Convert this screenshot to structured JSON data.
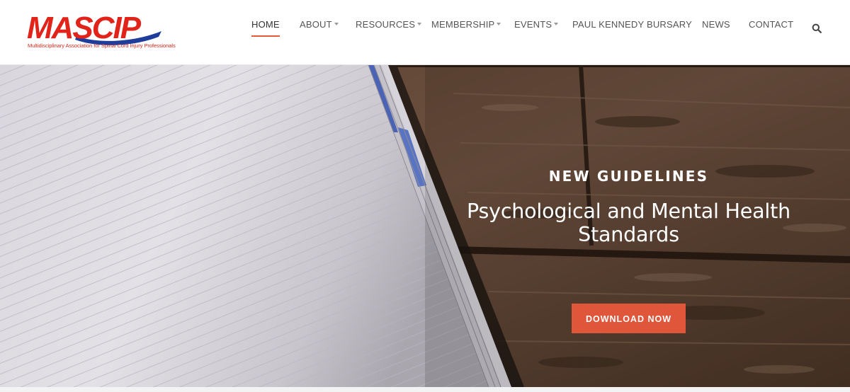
{
  "brand": {
    "name": "MASCIP",
    "tagline": "Multidisciplinary Association for Spinal Cord Injury Professionals",
    "colors": {
      "red": "#e2231a",
      "blue": "#1f3e9c",
      "accent": "#e0563a"
    }
  },
  "nav": {
    "items": [
      {
        "label": "HOME",
        "active": true,
        "dropdown": false
      },
      {
        "label": "ABOUT",
        "active": false,
        "dropdown": true
      },
      {
        "label": "RESOURCES",
        "active": false,
        "dropdown": true
      },
      {
        "label": "MEMBERSHIP",
        "active": false,
        "dropdown": true
      },
      {
        "label": "EVENTS",
        "active": false,
        "dropdown": true
      },
      {
        "label": "PAUL KENNEDY BURSARY",
        "active": false,
        "dropdown": false
      },
      {
        "label": "NEWS",
        "active": false,
        "dropdown": false
      },
      {
        "label": "CONTACT",
        "active": false,
        "dropdown": false
      }
    ],
    "search_icon": "search-icon"
  },
  "hero": {
    "eyebrow": "NEW GUIDELINES",
    "headline_line1": "Psychological and Mental Health",
    "headline_line2": "Standards",
    "cta_label": "DOWNLOAD NOW"
  }
}
